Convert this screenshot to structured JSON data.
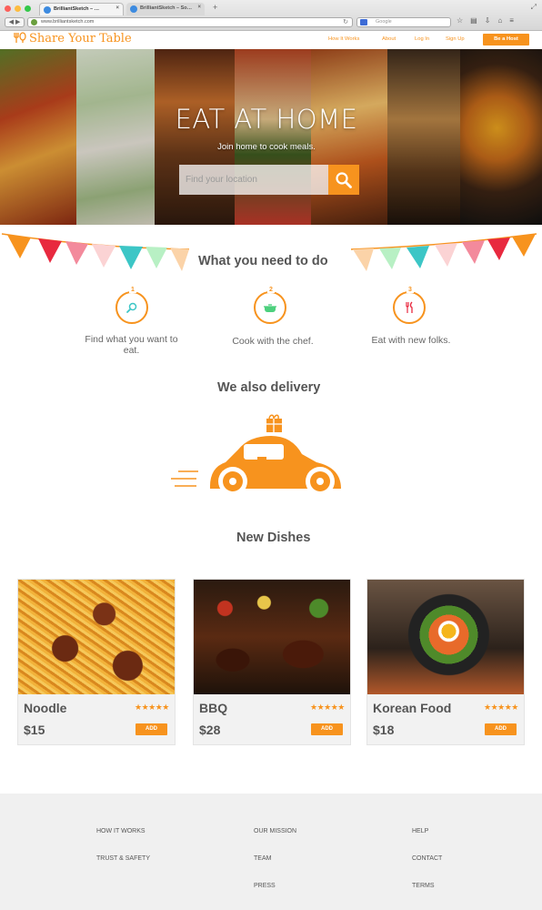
{
  "browser": {
    "tabs": [
      {
        "label": "BrilliantSketch – …"
      },
      {
        "label": "BrilliantSketch – So…"
      }
    ],
    "url": "www.brilliantsketch.com",
    "search_placeholder": "Google"
  },
  "header": {
    "logo_text": "Share Your Table",
    "nav": [
      "How It Works",
      "About",
      "Log In",
      "Sign Up"
    ],
    "cta": "Be a Host"
  },
  "hero": {
    "title": "EAT AT HOME",
    "subtitle": "Join home to cook meals.",
    "search_placeholder": "Find your location"
  },
  "steps_section": {
    "title": "What  you need to do",
    "steps": [
      {
        "number": "1",
        "text": "Find what you want to eat.",
        "icon": "search-icon"
      },
      {
        "number": "2",
        "text": "Cook with the chef.",
        "icon": "cooking-pot-icon"
      },
      {
        "number": "3",
        "text": "Eat with new folks.",
        "icon": "fork-knife-icon"
      }
    ]
  },
  "delivery_section": {
    "title": "We also delivery"
  },
  "dishes_section": {
    "title": "New Dishes",
    "dishes": [
      {
        "name": "Noodle",
        "price": "$15",
        "rating": 5,
        "add_label": "ADD"
      },
      {
        "name": "BBQ",
        "price": "$28",
        "rating": 5,
        "add_label": "ADD"
      },
      {
        "name": "Korean Food",
        "price": "$18",
        "rating": 5,
        "add_label": "ADD"
      }
    ]
  },
  "footer": {
    "columns": [
      [
        "HOW IT WORKS",
        "TRUST & SAFETY"
      ],
      [
        "OUR MISSION",
        "TEAM",
        "PRESS"
      ],
      [
        "HELP",
        "CONTACT",
        "TERMS"
      ]
    ]
  },
  "colors": {
    "accent": "#f7931e",
    "text": "#555555",
    "footer_bg": "#f0f0f0"
  }
}
